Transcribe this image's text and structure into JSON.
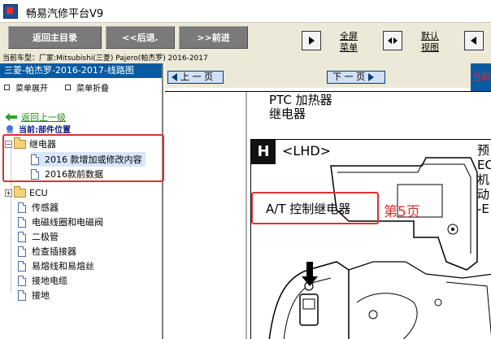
{
  "window": {
    "title": "畅易汽修平台V9"
  },
  "toolbar": {
    "home_label": "返回主目录",
    "back_label": "<<后退.",
    "forward_label": ">>前进",
    "fullscreen_line1": "全屏",
    "fullscreen_line2": "菜单",
    "default_line1": "默认",
    "default_line2": "视图"
  },
  "vehicle": {
    "text": "当前车型：厂家:Mitsubishi(三菱) Pajero(帕杰罗) 2016-2017"
  },
  "left": {
    "header": "三菱-帕杰罗-2016-2017-线路图",
    "expand": "菜单展开",
    "collapse": "菜单折叠",
    "back_link": "返回上一级",
    "current_location": "当前:部件位置"
  },
  "tree": {
    "relay": "继电器",
    "relay_children": [
      "2016 款增加或修改内容",
      "2016款前数据"
    ],
    "ecu": "ECU",
    "items": [
      "传感器",
      "电磁线圈和电磁阀",
      "二极管",
      "检查插接器",
      "易熔线和易熔丝",
      "接地电缆",
      "接地"
    ]
  },
  "pager": {
    "prev": "上 一 页",
    "next": "下 一 页",
    "current_partial": "当前"
  },
  "document": {
    "ptc_line1": "PTC 加热器",
    "ptc_line2": "继电器",
    "section_letter": "H",
    "lhd": "<LHD>",
    "side_text": "预\nEC\n机\n动\n-E",
    "at_label": "A/T 控制继电器",
    "page_note": "第5页"
  },
  "colors": {
    "accent_blue": "#0a5aa0",
    "highlight_red": "#e03030",
    "toolbar_gray": "#7a7a7a"
  }
}
